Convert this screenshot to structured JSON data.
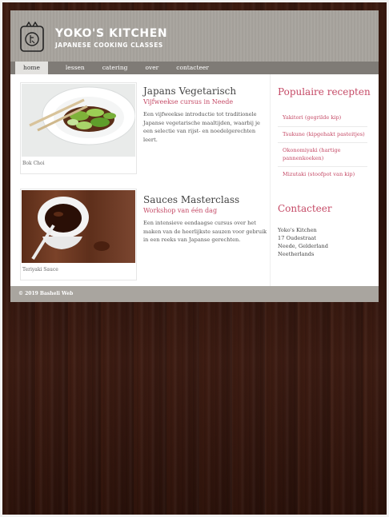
{
  "brand": {
    "title": "YOKO'S KITCHEN",
    "subtitle": "JAPANESE COOKING CLASSES",
    "logo_icon": "bowl-logo-icon"
  },
  "nav": {
    "items": [
      {
        "label": "home",
        "active": true
      },
      {
        "label": "lessen"
      },
      {
        "label": "catering"
      },
      {
        "label": "over"
      },
      {
        "label": "contacteer"
      }
    ]
  },
  "articles": [
    {
      "image_caption": "Bok Choi",
      "title": "Japans Vegetarisch",
      "subtitle": "Vijfweekse cursus in Neede",
      "body": "Een vijfweekse introductie tot traditionele Japanse vegetarische maaltijden, waarbij je een selectie van rijst- en noedelgerechten leert."
    },
    {
      "image_caption": "Teriyaki Sauce",
      "title": "Sauces Masterclass",
      "subtitle": "Workshop van één dag",
      "body": "Een intensieve eendaagse cursus over het maken van de heerlijkste sauzen voor gebruik in een reeks van Japanse gerechten."
    }
  ],
  "sidebar": {
    "recipes_title": "Populaire recepten",
    "recipes": [
      "Yakitori (gegrilde kip)",
      "Tsukune (kipgehakt pasteitjes)",
      "Okonomiyaki (hartige pannenkoeken)",
      "Mizutaki (stoofpot van kip)"
    ],
    "contact_title": "Contacteer",
    "address": [
      "Yoko's Kitchen",
      "17 Oudestraat",
      "Neede, Gelderland",
      "Neetherlands"
    ]
  },
  "footer": {
    "copyright": "© 2019 Basheli Web"
  },
  "colors": {
    "accent": "#c54a66",
    "header": "#a9a59f",
    "nav": "#7f7b76",
    "background_wood": "#3a1a10"
  }
}
